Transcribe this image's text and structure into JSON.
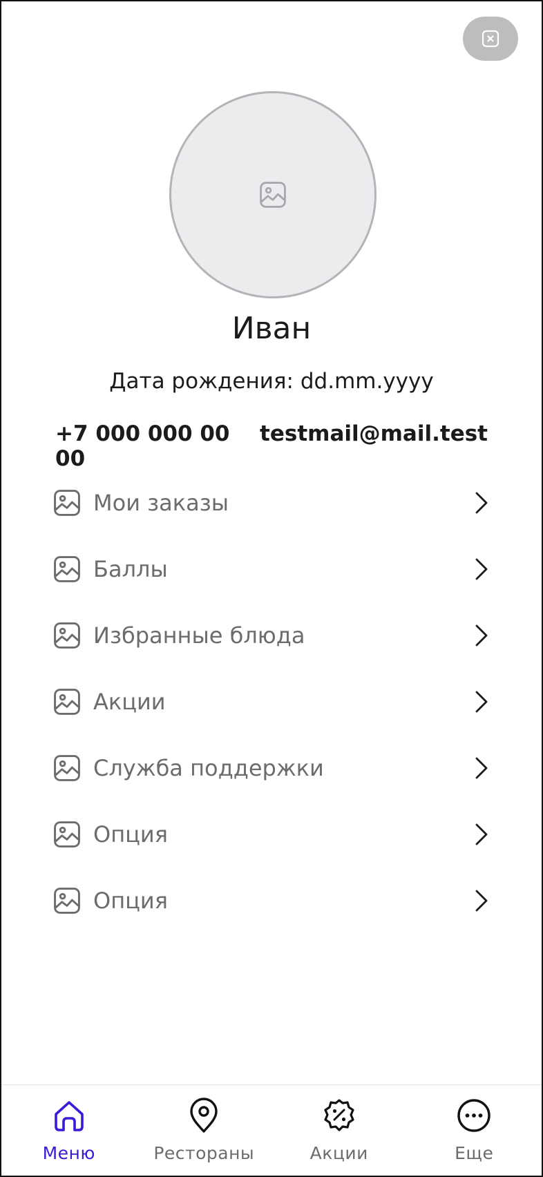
{
  "profile": {
    "name": "Иван",
    "birth_label": "Дата рождения: dd.mm.yyyy",
    "phone": "+7 000 000 00 00",
    "email": "testmail@mail.test"
  },
  "menu": {
    "items": [
      {
        "label": "Мои заказы",
        "icon": "image-placeholder-icon"
      },
      {
        "label": "Баллы",
        "icon": "image-placeholder-icon"
      },
      {
        "label": "Избранные блюда",
        "icon": "image-placeholder-icon"
      },
      {
        "label": "Акции",
        "icon": "image-placeholder-icon"
      },
      {
        "label": "Служба поддержки",
        "icon": "image-placeholder-icon"
      },
      {
        "label": "Опция",
        "icon": "image-placeholder-icon"
      },
      {
        "label": "Опция",
        "icon": "image-placeholder-icon"
      }
    ]
  },
  "tabbar": {
    "tabs": [
      {
        "label": "Меню",
        "icon": "home-icon",
        "active": true
      },
      {
        "label": "Рестораны",
        "icon": "location-pin-icon",
        "active": false
      },
      {
        "label": "Акции",
        "icon": "discount-badge-icon",
        "active": false
      },
      {
        "label": "Еще",
        "icon": "more-dots-icon",
        "active": false
      }
    ]
  },
  "colors": {
    "accent": "#3a1ad6",
    "text_muted": "#6b6b70",
    "close_bg": "#bdbdc0",
    "avatar_bg": "#ececee"
  }
}
